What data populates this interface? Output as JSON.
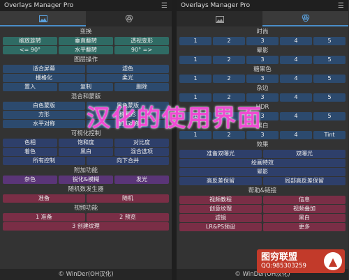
{
  "app": {
    "title": "Overlays Manager Pro",
    "menu_icon": "hamburger-icon"
  },
  "footer": "© WinDer(OH汉化)",
  "overlay_caption": "汉化的使用界面",
  "watermark": {
    "title": "图穷联盟",
    "qq": "QQ:985303259"
  },
  "left": {
    "tabs": [
      {
        "icon": "image-icon",
        "active": true
      },
      {
        "icon": "color-circles-icon",
        "active": false
      }
    ],
    "sections": [
      {
        "title": "变换",
        "color": "teal",
        "rows": [
          [
            "缩放旋转",
            "垂直翻转",
            "透视变形"
          ],
          [
            "<= 90°",
            "水平翻转",
            "90° =>"
          ]
        ]
      },
      {
        "title": "图层操作",
        "color": "blue",
        "rows": [
          [
            "适合屏幕",
            "滤色"
          ],
          [
            "栅格化",
            "柔光"
          ],
          [
            "置入",
            "复制",
            "删除"
          ]
        ]
      },
      {
        "title": "混合和蒙版",
        "color": "blue",
        "rows": [
          [
            "白色蒙版",
            "黑色蒙版"
          ],
          [
            "方形",
            "椭圆形"
          ],
          [
            "水平对称",
            "垂直对称"
          ]
        ]
      },
      {
        "title": "可视化控制",
        "color": "indigo",
        "rows": [
          [
            "色相",
            "饱和度",
            "对比度"
          ],
          [
            "着色",
            "黑白",
            "混合选项"
          ],
          [
            "所有控制",
            "向下合并"
          ]
        ]
      },
      {
        "title": "附加功能",
        "color": "purple",
        "rows": [
          [
            "杂色",
            "锐化&模糊",
            "发光"
          ]
        ]
      },
      {
        "title": "随机数发生器",
        "color": "pink",
        "rows": [
          [
            "准备",
            "随机"
          ]
        ]
      },
      {
        "title": "视频功能",
        "color": "pink",
        "rows": [
          [
            "1 准备",
            "2 预览"
          ],
          [
            "3 创建纹理"
          ]
        ]
      }
    ]
  },
  "right": {
    "tabs": [
      {
        "icon": "image-icon",
        "active": false
      },
      {
        "icon": "color-circles-icon",
        "active": true
      }
    ],
    "sections": [
      {
        "title": "时尚",
        "color": "blue",
        "rows": [
          [
            "1",
            "2",
            "3",
            "4",
            "5"
          ]
        ]
      },
      {
        "title": "晕影",
        "color": "blue",
        "rows": [
          [
            "1",
            "2",
            "3",
            "4",
            "5"
          ]
        ]
      },
      {
        "title": "糖果色",
        "color": "blue",
        "rows": [
          [
            "1",
            "2",
            "3",
            "4",
            "5"
          ]
        ]
      },
      {
        "title": "杂边",
        "color": "blue",
        "rows": [
          [
            "1",
            "2",
            "3",
            "4",
            "5"
          ]
        ]
      },
      {
        "title": "HDR",
        "color": "blue",
        "rows": [
          [
            "1",
            "2",
            "3",
            "4",
            "5"
          ]
        ]
      },
      {
        "title": "黑白",
        "color": "blue",
        "rows": [
          [
            "1",
            "2",
            "3",
            "4",
            "Tint"
          ]
        ]
      },
      {
        "title": "效果",
        "color": "indigo",
        "rows": [
          [
            "准备双曝光",
            "双曝光"
          ],
          [
            "绘画特效"
          ],
          [
            "晕影"
          ],
          [
            "高反差保留",
            "局部高反差保留"
          ]
        ]
      },
      {
        "title": "帮助&链接",
        "color": "pink",
        "rows": [
          [
            "视频教程",
            "信息"
          ],
          [
            "创意纹理",
            "视频叠加"
          ],
          [
            "滤镜",
            "黑白"
          ],
          [
            "LR&PS预设",
            "更多"
          ]
        ]
      }
    ]
  }
}
